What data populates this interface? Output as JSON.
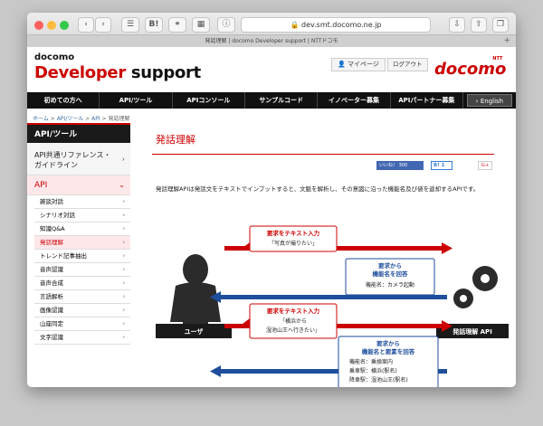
{
  "browser": {
    "url": "dev.smt.docomo.ne.jp",
    "tab_title": "発話理解 | docomo Developer support | NTTドコモ",
    "tab_add": "+"
  },
  "header": {
    "logo_small": "docomo",
    "logo_developer": "Developer",
    "logo_support": "support",
    "mypage": "マイページ",
    "logout": "ログアウト",
    "brand": "docomo",
    "brand_ntt": "NTT"
  },
  "nav": {
    "items": [
      "初めての方へ",
      "API/ツール",
      "APIコンソール",
      "サンプルコード",
      "イノベーター募集",
      "APIパートナー募集"
    ],
    "english": "English"
  },
  "breadcrumb": {
    "home": "ホーム",
    "api_tools": "API/ツール",
    "api": "API",
    "current": "発話理解",
    "sep": ">"
  },
  "sidebar": {
    "heading": "API/ツール",
    "common_ref": "API共通リファレンス・ガイドライン",
    "api": "API",
    "items": [
      "雑談対話",
      "シナリオ対話",
      "知識Q&A",
      "発話理解",
      "トレンド記事抽出",
      "音声認識",
      "音声合成",
      "言語解析",
      "画像認識",
      "山座同定",
      "文字認識"
    ],
    "active_index": 3
  },
  "main": {
    "title": "発話理解",
    "like_label": "いいね！ 300",
    "hatena_label": "B! 1",
    "gplus_label": "G+",
    "description": "発話理解APIは発話文をテキストでインプットすると、文脈を解析し、その意図に沿った機能名及び値を返却するAPIです。"
  },
  "diagram": {
    "user_label": "ユーザ",
    "api_label": "発話理解 API",
    "bubble1_title": "要求をテキスト入力",
    "bubble1_text": "「写真が撮りたい」",
    "bubble2_title": "要求から",
    "bubble2_title2": "機能名を回答",
    "bubble2_text": "機能名：カメラ起動",
    "bubble3_title": "要求をテキスト入力",
    "bubble3_text1": "「横浜から",
    "bubble3_text2": "湿池山王へ行きたい」",
    "bubble4_title": "要求から",
    "bubble4_title2": "機能名と要素を回答",
    "bubble4_text1": "機能名：乗換案内",
    "bubble4_text2": "乗車駅：横浜(駅名)",
    "bubble4_text3": "降車駅：湿池山王(駅名)",
    "colors": {
      "red": "#cc0000",
      "blue": "#1f4e9c",
      "dark": "#1a1a1a"
    }
  }
}
